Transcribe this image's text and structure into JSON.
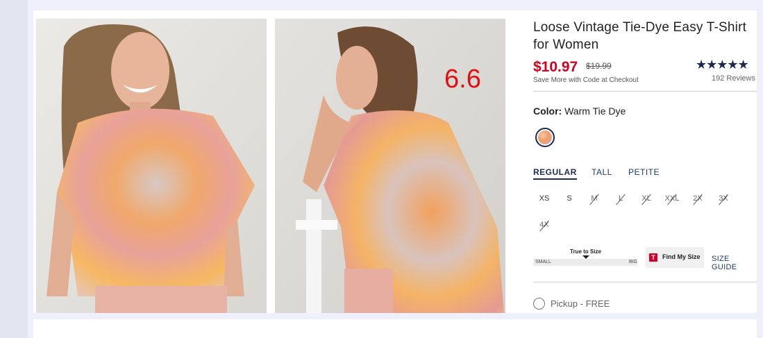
{
  "overlay_number": "6.6",
  "product": {
    "title": "Loose Vintage Tie-Dye Easy T-Shirt for Women",
    "price": "$10.97",
    "original_price": "$19.99",
    "promo": "Save More with Code at Checkout",
    "rating": 4.5,
    "stars_display": "★★★★★",
    "reviews": "192 Reviews"
  },
  "color": {
    "label": "Color:",
    "value": "Warm Tie Dye"
  },
  "fit_tabs": [
    {
      "label": "REGULAR",
      "active": true
    },
    {
      "label": "TALL",
      "active": false
    },
    {
      "label": "PETITE",
      "active": false
    }
  ],
  "sizes": [
    {
      "label": "XS",
      "available": true
    },
    {
      "label": "S",
      "available": true
    },
    {
      "label": "M",
      "available": false
    },
    {
      "label": "L",
      "available": false
    },
    {
      "label": "XL",
      "available": false
    },
    {
      "label": "XXL",
      "available": false
    },
    {
      "label": "2X",
      "available": false
    },
    {
      "label": "3X",
      "available": false
    },
    {
      "label": "4X",
      "available": false
    }
  ],
  "fit_scale": {
    "title": "True to Size",
    "min_label": "SMALL",
    "max_label": "BIG"
  },
  "find_my_size": {
    "icon": "T",
    "label": "Find My Size"
  },
  "size_guide": "SIZE GUIDE",
  "pickup": "Pickup - FREE",
  "colors": {
    "price_red": "#d6001c",
    "navy": "#1c2a52",
    "overlay_red": "#e01010"
  }
}
